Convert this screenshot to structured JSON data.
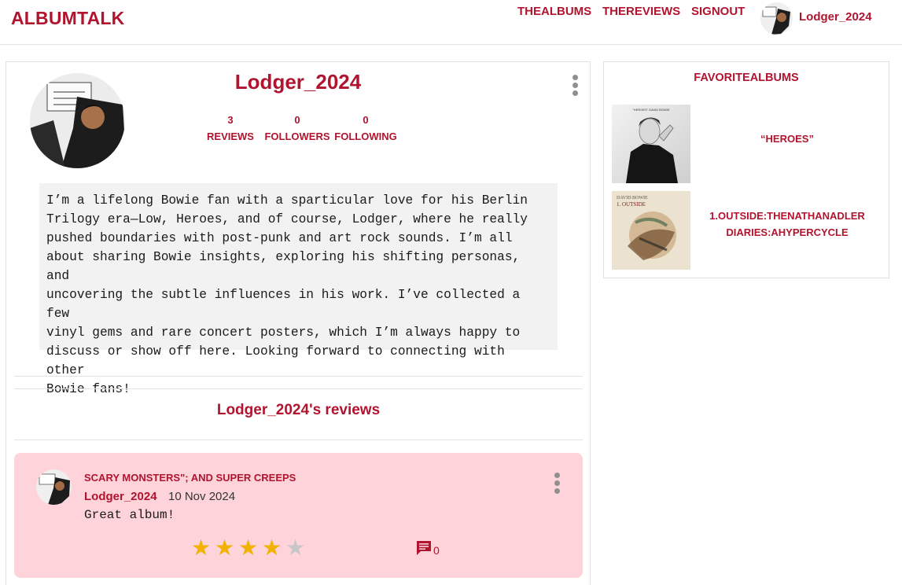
{
  "header": {
    "logo": "ALBUMTALK",
    "nav": [
      "THEALBUMS",
      "THEREVIEWS",
      "SIGNOUT"
    ],
    "username": "Lodger_2024",
    "avatar_icon": "user-avatar-icon"
  },
  "profile": {
    "username": "Lodger_2024",
    "stats": [
      {
        "count": "3",
        "label": "REVIEWS"
      },
      {
        "count": "0",
        "label": "FOLLOWERS"
      },
      {
        "count": "0",
        "label": "FOLLOWING"
      }
    ],
    "bio_lines": [
      "I’m a lifelong Bowie fan with a sparticular love for his Berlin",
      "Trilogy era—Low, Heroes, and of course, Lodger, where he really",
      "pushed boundaries with post-punk and art rock sounds. I’m all",
      "about sharing Bowie insights, exploring his shifting personas, and",
      "uncovering the subtle influences in his work. I’ve collected a few",
      "vinyl gems and rare concert posters, which I’m always happy to",
      "discuss or show off here. Looking forward to connecting with other",
      "Bowie fans!"
    ],
    "options_icon": "more-vertical-icon"
  },
  "reviews_section": {
    "heading": "Lodger_2024's reviews",
    "reviews": [
      {
        "album": "SCARY MONSTERS\"; AND SUPER CREEPS",
        "user": "Lodger_2024",
        "date": "10 Nov 2024",
        "text": "Great album!",
        "rating": 4,
        "rating_max": 5,
        "comment_count": "0"
      }
    ]
  },
  "favorites": {
    "title": "FAVORITEALBUMS",
    "albums": [
      {
        "name": "“HEROES”"
      },
      {
        "name_lines": [
          "1.OUTSIDE:THENATHANADLER",
          "DIARIES:AHYPERCYCLE"
        ]
      }
    ]
  },
  "colors": {
    "accent": "#b0142f",
    "review_card_bg": "#ffd3da",
    "star_filled": "#f2b200",
    "star_empty": "#c7c7c7"
  }
}
